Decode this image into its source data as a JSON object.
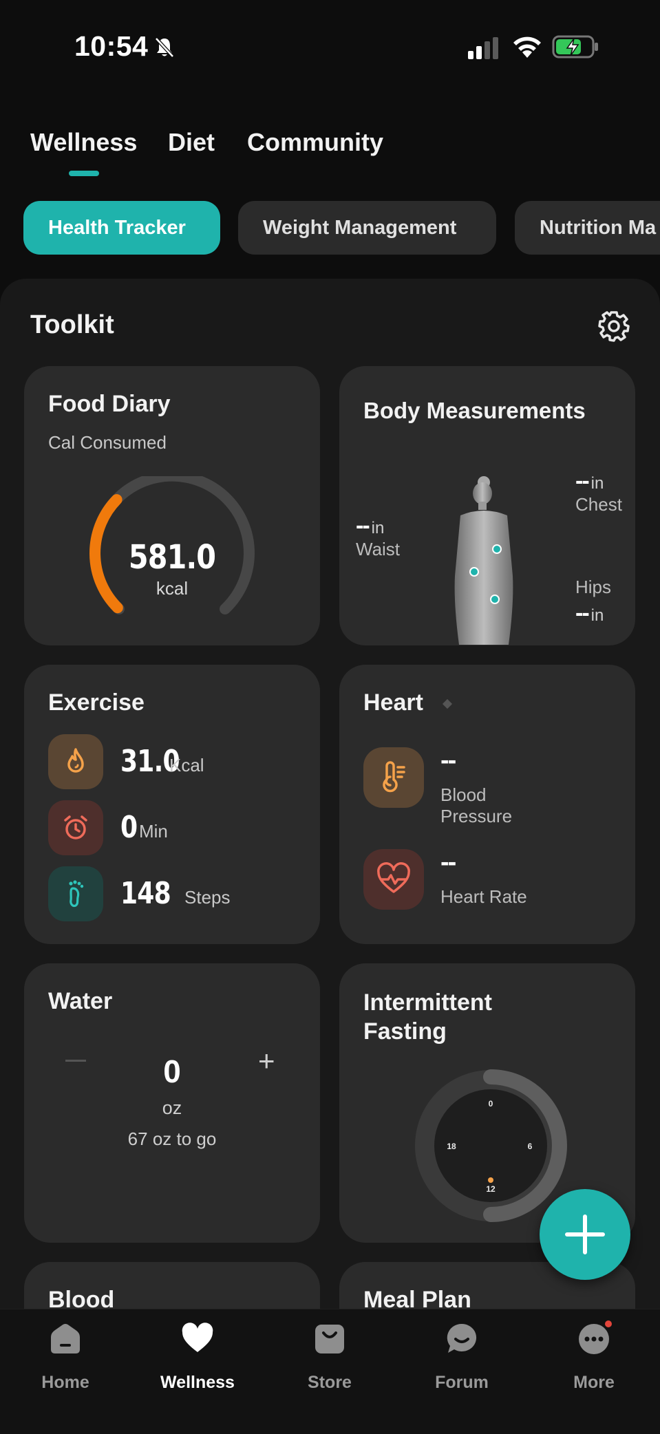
{
  "status_bar": {
    "time": "10:54"
  },
  "top_tabs": [
    {
      "label": "Wellness",
      "active": true
    },
    {
      "label": "Diet",
      "active": false
    },
    {
      "label": "Community",
      "active": false
    }
  ],
  "chips": [
    {
      "label": "Health Tracker",
      "active": true
    },
    {
      "label": "Weight Management",
      "active": false
    },
    {
      "label": "Nutrition Ma",
      "active": false
    }
  ],
  "toolkit": {
    "title": "Toolkit",
    "food_diary": {
      "title": "Food Diary",
      "subtitle": "Cal Consumed",
      "value": "581.0",
      "unit": "kcal",
      "progress": 0.33
    },
    "body_measurements": {
      "title": "Body Measurements",
      "chest": {
        "value": "--",
        "unit": "in",
        "label": "Chest"
      },
      "waist": {
        "value": "--",
        "unit": "in",
        "label": "Waist"
      },
      "hips": {
        "value": "--",
        "unit": "in",
        "label": "Hips"
      }
    },
    "exercise": {
      "title": "Exercise",
      "rows": [
        {
          "value": "31.0",
          "unit": "Kcal",
          "icon": "flame-icon"
        },
        {
          "value": "0",
          "unit": "Min",
          "icon": "alarm-clock-icon"
        },
        {
          "value": "148",
          "unit": "Steps",
          "icon": "footprint-icon"
        }
      ]
    },
    "heart": {
      "title": "Heart",
      "blood_pressure": {
        "value": "--",
        "label_line1": "Blood",
        "label_line2": "Pressure"
      },
      "heart_rate": {
        "value": "--",
        "label": "Heart Rate"
      }
    },
    "water": {
      "title": "Water",
      "value": "0",
      "unit": "oz",
      "remaining": "67 oz to go",
      "minus": "–",
      "plus": "+"
    },
    "fasting": {
      "title_line1": "Intermittent",
      "title_line2": "Fasting",
      "clock_labels": {
        "top": "0",
        "right": "6",
        "bottom": "12",
        "left": "18"
      }
    },
    "blood": {
      "title": "Blood"
    },
    "meal_plan": {
      "title": "Meal Plan"
    }
  },
  "colors": {
    "accent": "#1fb3ac",
    "orange": "#f07a0c",
    "card": "#2b2b2b",
    "panel": "#191919"
  },
  "bottom_nav": [
    {
      "label": "Home",
      "icon": "home-icon",
      "active": false
    },
    {
      "label": "Wellness",
      "icon": "heart-icon",
      "active": true
    },
    {
      "label": "Store",
      "icon": "shopping-bag-icon",
      "active": false
    },
    {
      "label": "Forum",
      "icon": "chat-bubble-icon",
      "active": false
    },
    {
      "label": "More",
      "icon": "more-dots-icon",
      "active": false,
      "badge": true
    }
  ]
}
